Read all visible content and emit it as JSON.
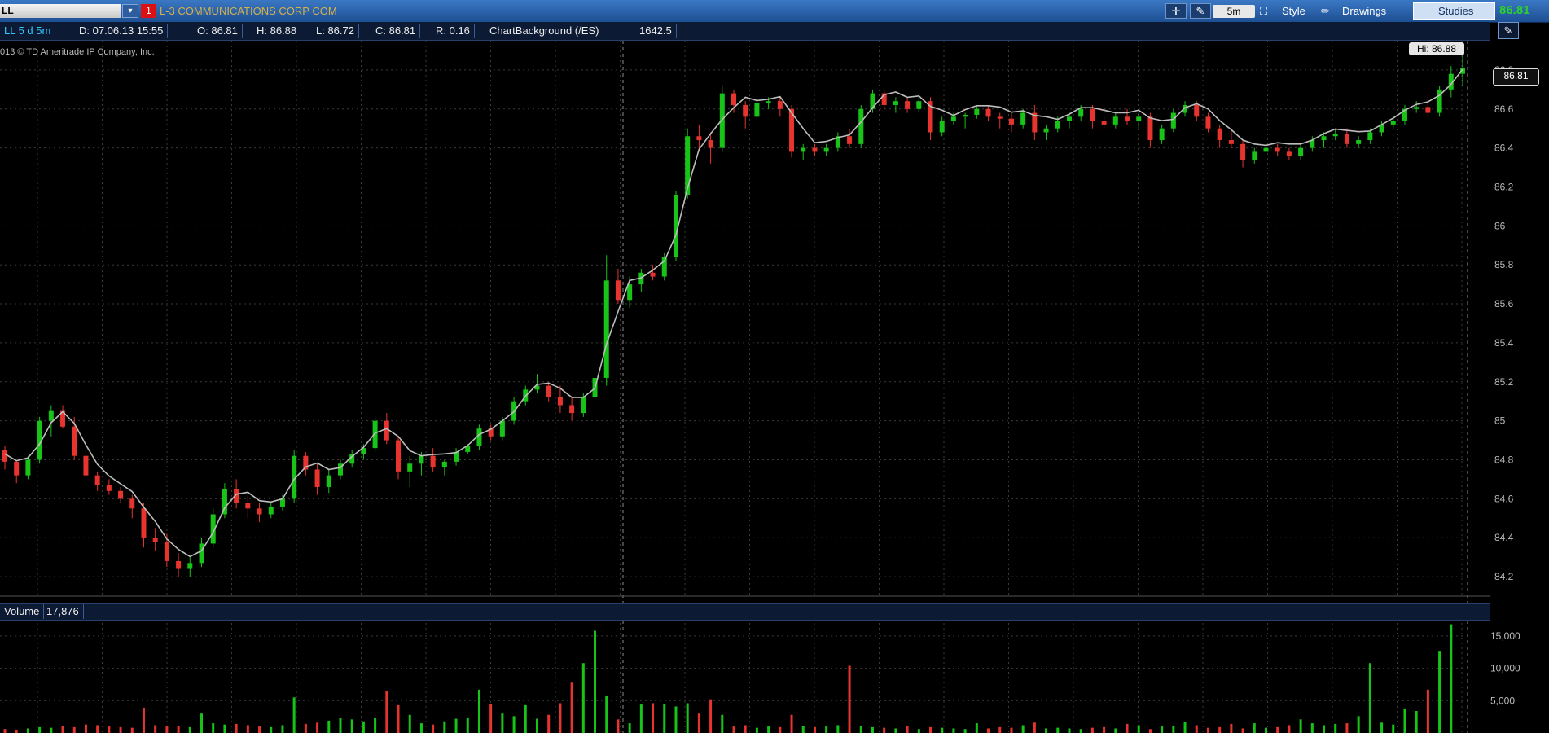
{
  "toolbar": {
    "symbol": "LL",
    "alert_count": "1",
    "company": "L-3 COMMUNICATIONS CORP COM",
    "timeframe": "5m",
    "style_label": "Style",
    "drawings_label": "Drawings",
    "studies_label": "Studies",
    "last_price": "86.81"
  },
  "infobar": {
    "period": "LL 5 d 5m",
    "date": "D: 07.06.13 15:55",
    "open": "O: 86.81",
    "high": "H: 86.88",
    "low": "L: 86.72",
    "close": "C: 86.81",
    "range": "R: 0.16",
    "background": "ChartBackground (/ES)",
    "background_value": "1642.5"
  },
  "copyright": "013 © TD Ameritrade IP Company, Inc.",
  "hi_label": "Hi: 86.88",
  "price_tag": "86.81",
  "volume": {
    "label": "Volume",
    "value": "17,876"
  },
  "colors": {
    "up": "#17c417",
    "down": "#e8342f",
    "line": "#bdbdbd",
    "volume_last": "#cfcfcf"
  },
  "chart_data": {
    "type": "candlestick",
    "price_axis": {
      "ticks": [
        "86.8",
        "86.6",
        "86.4",
        "86.2",
        "86",
        "85.8",
        "85.6",
        "85.4",
        "85.2",
        "85",
        "84.8",
        "84.6",
        "84.4",
        "84.2"
      ],
      "range": [
        84.1,
        86.95
      ]
    },
    "volume_axis": {
      "ticks": [
        "15,000",
        "10,000",
        "5,000"
      ],
      "range": [
        0,
        17000
      ]
    },
    "grid": true,
    "candles": [
      [
        84.85,
        84.87,
        84.75,
        84.79
      ],
      [
        84.79,
        84.8,
        84.68,
        84.72
      ],
      [
        84.72,
        84.82,
        84.7,
        84.8
      ],
      [
        84.8,
        85.02,
        84.78,
        85.0
      ],
      [
        85.0,
        85.08,
        84.92,
        85.05
      ],
      [
        85.05,
        85.08,
        84.96,
        84.97
      ],
      [
        84.97,
        85.02,
        84.8,
        84.82
      ],
      [
        84.82,
        84.85,
        84.7,
        84.72
      ],
      [
        84.72,
        84.74,
        84.64,
        84.67
      ],
      [
        84.67,
        84.7,
        84.62,
        84.64
      ],
      [
        84.64,
        84.66,
        84.58,
        84.6
      ],
      [
        84.6,
        84.62,
        84.5,
        84.55
      ],
      [
        84.55,
        84.58,
        84.35,
        84.4
      ],
      [
        84.4,
        84.45,
        84.33,
        84.38
      ],
      [
        84.38,
        84.42,
        84.25,
        84.28
      ],
      [
        84.28,
        84.32,
        84.2,
        84.24
      ],
      [
        84.24,
        84.3,
        84.2,
        84.27
      ],
      [
        84.27,
        84.4,
        84.25,
        84.37
      ],
      [
        84.37,
        84.55,
        84.35,
        84.52
      ],
      [
        84.52,
        84.68,
        84.5,
        84.65
      ],
      [
        84.65,
        84.7,
        84.55,
        84.58
      ],
      [
        84.58,
        84.62,
        84.5,
        84.55
      ],
      [
        84.55,
        84.58,
        84.48,
        84.52
      ],
      [
        84.52,
        84.58,
        84.5,
        84.56
      ],
      [
        84.56,
        84.62,
        84.54,
        84.6
      ],
      [
        84.6,
        84.85,
        84.58,
        84.82
      ],
      [
        84.82,
        84.84,
        84.72,
        84.75
      ],
      [
        84.75,
        84.78,
        84.62,
        84.66
      ],
      [
        84.66,
        84.75,
        84.63,
        84.72
      ],
      [
        84.72,
        84.8,
        84.7,
        84.78
      ],
      [
        84.78,
        84.85,
        84.76,
        84.83
      ],
      [
        84.83,
        84.88,
        84.8,
        84.86
      ],
      [
        84.86,
        85.02,
        84.84,
        85.0
      ],
      [
        85.0,
        85.04,
        84.88,
        84.9
      ],
      [
        84.9,
        84.92,
        84.7,
        84.74
      ],
      [
        84.74,
        84.82,
        84.66,
        84.78
      ],
      [
        84.78,
        84.84,
        84.72,
        84.82
      ],
      [
        84.82,
        84.86,
        84.74,
        84.76
      ],
      [
        84.76,
        84.8,
        84.72,
        84.79
      ],
      [
        84.79,
        84.86,
        84.77,
        84.84
      ],
      [
        84.84,
        84.88,
        84.83,
        84.87
      ],
      [
        84.87,
        84.98,
        84.85,
        84.96
      ],
      [
        84.96,
        84.98,
        84.9,
        84.92
      ],
      [
        84.92,
        85.02,
        84.9,
        85.0
      ],
      [
        85.0,
        85.12,
        84.98,
        85.1
      ],
      [
        85.1,
        85.18,
        85.08,
        85.16
      ],
      [
        85.16,
        85.24,
        85.14,
        85.18
      ],
      [
        85.18,
        85.2,
        85.1,
        85.12
      ],
      [
        85.12,
        85.18,
        85.04,
        85.08
      ],
      [
        85.08,
        85.12,
        85.0,
        85.04
      ],
      [
        85.04,
        85.14,
        85.02,
        85.12
      ],
      [
        85.12,
        85.25,
        85.1,
        85.22
      ],
      [
        85.22,
        85.85,
        85.18,
        85.72
      ],
      [
        85.72,
        85.78,
        85.6,
        85.62
      ],
      [
        85.62,
        85.74,
        85.58,
        85.7
      ],
      [
        85.7,
        85.78,
        85.66,
        85.76
      ],
      [
        85.76,
        85.8,
        85.72,
        85.74
      ],
      [
        85.74,
        85.86,
        85.72,
        85.84
      ],
      [
        85.84,
        86.18,
        85.82,
        86.16
      ],
      [
        86.16,
        86.5,
        86.14,
        86.46
      ],
      [
        86.46,
        86.52,
        86.38,
        86.44
      ],
      [
        86.44,
        86.48,
        86.32,
        86.4
      ],
      [
        86.4,
        86.72,
        86.38,
        86.68
      ],
      [
        86.68,
        86.7,
        86.58,
        86.62
      ],
      [
        86.62,
        86.64,
        86.5,
        86.56
      ],
      [
        86.56,
        86.64,
        86.55,
        86.63
      ],
      [
        86.63,
        86.66,
        86.6,
        86.64
      ],
      [
        86.64,
        86.66,
        86.56,
        86.6
      ],
      [
        86.6,
        86.62,
        86.35,
        86.38
      ],
      [
        86.38,
        86.42,
        86.34,
        86.4
      ],
      [
        86.4,
        86.42,
        86.36,
        86.38
      ],
      [
        86.38,
        86.42,
        86.36,
        86.4
      ],
      [
        86.4,
        86.48,
        86.38,
        86.46
      ],
      [
        86.46,
        86.5,
        86.4,
        86.42
      ],
      [
        86.42,
        86.62,
        86.4,
        86.6
      ],
      [
        86.6,
        86.7,
        86.58,
        86.68
      ],
      [
        86.68,
        86.7,
        86.6,
        86.62
      ],
      [
        86.62,
        86.66,
        86.58,
        86.64
      ],
      [
        86.64,
        86.66,
        86.58,
        86.6
      ],
      [
        86.6,
        86.66,
        86.58,
        86.64
      ],
      [
        86.64,
        86.66,
        86.44,
        86.48
      ],
      [
        86.48,
        86.56,
        86.46,
        86.54
      ],
      [
        86.54,
        86.58,
        86.52,
        86.56
      ],
      [
        86.56,
        86.58,
        86.5,
        86.57
      ],
      [
        86.57,
        86.62,
        86.55,
        86.6
      ],
      [
        86.6,
        86.62,
        86.54,
        86.56
      ],
      [
        86.56,
        86.58,
        86.5,
        86.55
      ],
      [
        86.55,
        86.58,
        86.48,
        86.52
      ],
      [
        86.52,
        86.6,
        86.5,
        86.58
      ],
      [
        86.58,
        86.62,
        86.44,
        86.48
      ],
      [
        86.48,
        86.52,
        86.44,
        86.5
      ],
      [
        86.5,
        86.56,
        86.48,
        86.54
      ],
      [
        86.54,
        86.58,
        86.5,
        86.56
      ],
      [
        86.56,
        86.62,
        86.54,
        86.6
      ],
      [
        86.6,
        86.62,
        86.5,
        86.54
      ],
      [
        86.54,
        86.56,
        86.5,
        86.52
      ],
      [
        86.52,
        86.58,
        86.5,
        86.56
      ],
      [
        86.56,
        86.6,
        86.52,
        86.54
      ],
      [
        86.54,
        86.58,
        86.5,
        86.56
      ],
      [
        86.56,
        86.58,
        86.4,
        86.44
      ],
      [
        86.44,
        86.52,
        86.42,
        86.5
      ],
      [
        86.5,
        86.6,
        86.48,
        86.58
      ],
      [
        86.58,
        86.64,
        86.56,
        86.62
      ],
      [
        86.62,
        86.64,
        86.54,
        86.56
      ],
      [
        86.56,
        86.58,
        86.48,
        86.5
      ],
      [
        86.5,
        86.52,
        86.4,
        86.44
      ],
      [
        86.44,
        86.5,
        86.4,
        86.42
      ],
      [
        86.42,
        86.44,
        86.3,
        86.34
      ],
      [
        86.34,
        86.4,
        86.32,
        86.38
      ],
      [
        86.38,
        86.42,
        86.36,
        86.4
      ],
      [
        86.4,
        86.42,
        86.36,
        86.38
      ],
      [
        86.38,
        86.4,
        86.34,
        86.36
      ],
      [
        86.36,
        86.42,
        86.34,
        86.4
      ],
      [
        86.4,
        86.46,
        86.38,
        86.44
      ],
      [
        86.44,
        86.48,
        86.4,
        86.46
      ],
      [
        86.46,
        86.5,
        86.44,
        86.47
      ],
      [
        86.47,
        86.5,
        86.4,
        86.42
      ],
      [
        86.42,
        86.46,
        86.4,
        86.44
      ],
      [
        86.44,
        86.5,
        86.42,
        86.48
      ],
      [
        86.48,
        86.54,
        86.46,
        86.52
      ],
      [
        86.52,
        86.56,
        86.5,
        86.54
      ],
      [
        86.54,
        86.62,
        86.52,
        86.6
      ],
      [
        86.6,
        86.64,
        86.58,
        86.61
      ],
      [
        86.61,
        86.68,
        86.56,
        86.58
      ],
      [
        86.58,
        86.72,
        86.56,
        86.7
      ],
      [
        86.7,
        86.82,
        86.66,
        86.78
      ],
      [
        86.78,
        86.88,
        86.72,
        86.81
      ]
    ],
    "volume": [
      600,
      500,
      700,
      900,
      800,
      1100,
      900,
      1300,
      1200,
      1000,
      900,
      800,
      3900,
      1200,
      1000,
      1100,
      900,
      3000,
      1500,
      1300,
      1400,
      1200,
      1000,
      900,
      1200,
      5500,
      1400,
      1600,
      1900,
      2400,
      2100,
      1800,
      2300,
      6500,
      4300,
      2800,
      1500,
      1300,
      1800,
      2200,
      2400,
      6700,
      4500,
      3000,
      2600,
      4300,
      2200,
      2800,
      4600,
      7900,
      10800,
      15800,
      5800,
      2100,
      1500,
      4400,
      4600,
      4500,
      4100,
      4600,
      3000,
      5200,
      2800,
      1000,
      1200,
      800,
      1000,
      900,
      2800,
      1100,
      900,
      1000,
      1200,
      10400,
      1000,
      900,
      800,
      700,
      1000,
      600,
      900,
      800,
      700,
      600,
      1500,
      700,
      900,
      800,
      1200,
      1600,
      700,
      800,
      700,
      600,
      800,
      900,
      700,
      1400,
      1200,
      600,
      1000,
      1100,
      1700,
      1200,
      800,
      900,
      1400,
      700,
      1500,
      800,
      900,
      1200,
      2100,
      1500,
      1200,
      1400,
      1500,
      2600,
      10800,
      1600,
      1300,
      3700,
      3400,
      6700,
      12700,
      16800
    ]
  }
}
